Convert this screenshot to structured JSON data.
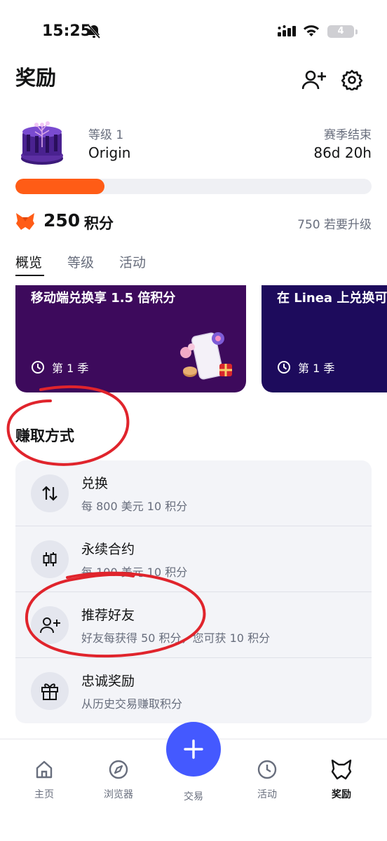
{
  "status_bar": {
    "time": "15:25",
    "battery": "4"
  },
  "header": {
    "title": "奖励"
  },
  "season": {
    "level_label": "等级 1",
    "level_name": "Origin",
    "end_label": "赛季结束",
    "end_value": "86d 20h",
    "progress": 0.25
  },
  "points": {
    "value": "250",
    "unit": "积分",
    "next_level": "750 若要升级"
  },
  "tabs": [
    {
      "label": "概览",
      "active": true
    },
    {
      "label": "等级",
      "active": false
    },
    {
      "label": "活动",
      "active": false
    }
  ],
  "campaigns": [
    {
      "title": "移动端兑换享 1.5 倍积分",
      "season": "第 1 季"
    },
    {
      "title": "在 Linea 上兑换可",
      "season": "第 1 季"
    }
  ],
  "earn": {
    "title": "赚取方式",
    "items": [
      {
        "title": "兑换",
        "subtitle": "每 800 美元 10 积分",
        "icon": "swap-arrows-icon"
      },
      {
        "title": "永续合约",
        "subtitle": "每 100 美元 10 积分",
        "icon": "candlestick-icon"
      },
      {
        "title": "推荐好友",
        "subtitle": "好友每获得 50 积分，您可获 10 积分",
        "icon": "add-user-icon"
      },
      {
        "title": "忠诚奖励",
        "subtitle": "从历史交易赚取积分",
        "icon": "gift-icon"
      }
    ]
  },
  "bottom_nav": [
    {
      "label": "主页",
      "icon": "home-icon"
    },
    {
      "label": "浏览器",
      "icon": "compass-icon"
    },
    {
      "label": "交易",
      "icon": "plus-icon"
    },
    {
      "label": "活动",
      "icon": "clock-icon"
    },
    {
      "label": "奖励",
      "icon": "fox-icon",
      "active": true
    }
  ],
  "colors": {
    "accent_orange": "#ff5c16",
    "trade_button": "#4459ff",
    "card_purple": "#3d0a5c",
    "card_indigo": "#1d0b5c",
    "annotation_red": "#e0242c"
  }
}
